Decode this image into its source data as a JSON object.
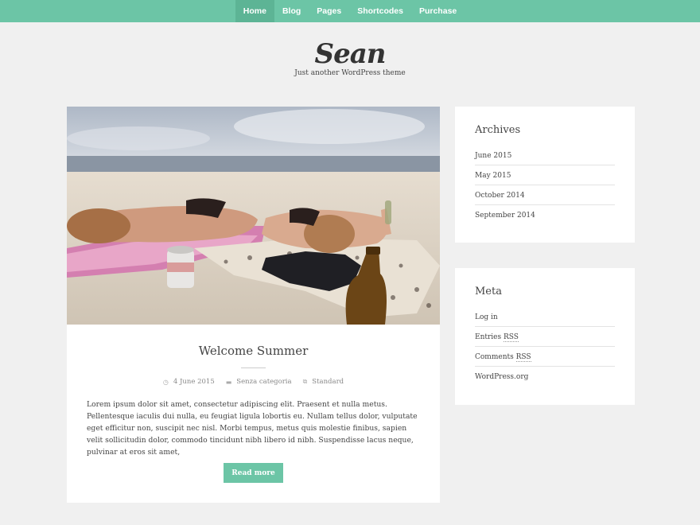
{
  "nav": {
    "items": [
      "Home",
      "Blog",
      "Pages",
      "Shortcodes",
      "Purchase"
    ],
    "active": "Home"
  },
  "site": {
    "title": "Sean",
    "tagline": "Just another WordPress theme"
  },
  "post": {
    "image_alt": "beach",
    "title": "Welcome Summer",
    "date": "4 June 2015",
    "category": "Senza categoria",
    "format": "Standard",
    "excerpt": "Lorem ipsum dolor sit amet, consectetur adipiscing elit. Praesent et nulla metus. Pellentesque iaculis dui nulla, eu feugiat ligula lobortis eu. Nullam tellus dolor, vulputate eget efficitur non, suscipit nec nisl. Morbi tempus, metus quis molestie finibus, sapien velit sollicitudin dolor, commodo tincidunt nibh libero id nibh. Suspendisse lacus neque, pulvinar at eros sit amet,",
    "read_more": "Read more"
  },
  "archives": {
    "title": "Archives",
    "items": [
      "June 2015",
      "May 2015",
      "October 2014",
      "September 2014"
    ]
  },
  "meta_widget": {
    "title": "Meta",
    "items": [
      {
        "pre": "Log in",
        "abbr": ""
      },
      {
        "pre": "Entries ",
        "abbr": "RSS"
      },
      {
        "pre": "Comments ",
        "abbr": "RSS"
      },
      {
        "pre": "WordPress.org",
        "abbr": ""
      }
    ]
  },
  "colors": {
    "accent": "#6cc5a6",
    "background": "#f0f0f0"
  },
  "icons": {
    "date": "clock-icon",
    "category": "folder-icon",
    "format": "format-icon"
  }
}
